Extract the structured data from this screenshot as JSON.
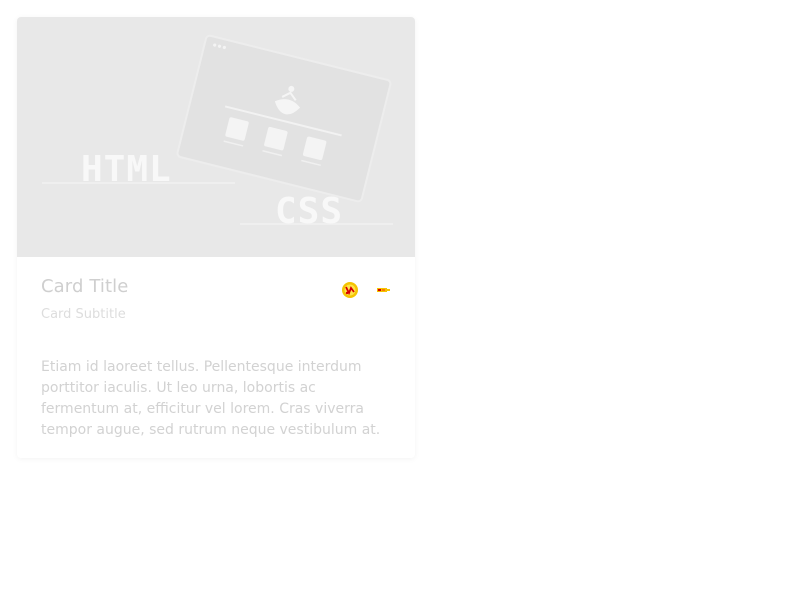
{
  "card": {
    "media": {
      "word_html": "HTML",
      "word_css": "CSS"
    },
    "title": "Card Title",
    "subtitle": "Card Subtitle",
    "text": "Etiam id laoreet tellus. Pellentesque interdum porttitor iaculis. Ut leo urna, lobortis ac fermentum at, efficitur vel lorem. Cras viverra tempor augue, sed rutrum neque vestibulum at.",
    "actions": [
      {
        "icon": "badge-icon",
        "color": "#e8c000"
      },
      {
        "icon": "flag-icon",
        "color": "#e8c000"
      }
    ]
  },
  "colors": {
    "media_bg": "#e8e8e8",
    "media_fg": "#f7f7f7",
    "title": "#cfcfcf",
    "subtitle": "#dddddd",
    "body_text": "#d2d2d2"
  }
}
